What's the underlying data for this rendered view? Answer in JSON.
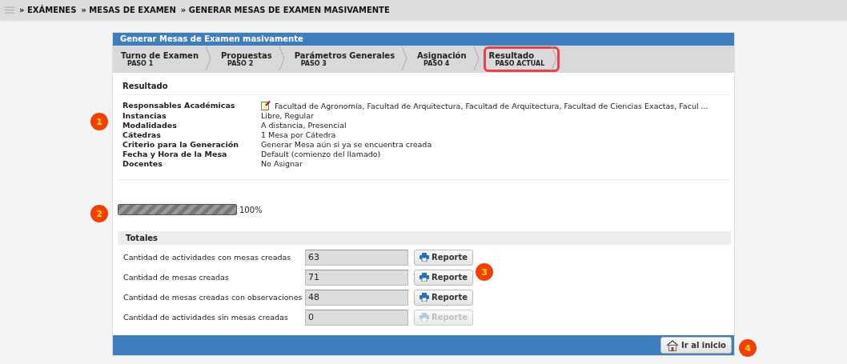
{
  "breadcrumb": [
    "» EXÁMENES",
    "» MESAS DE EXAMEN",
    "» GENERAR MESAS DE EXAMEN MASIVAMENTE"
  ],
  "panel": {
    "title": "Generar Mesas de Examen masivamente"
  },
  "steps": [
    {
      "title": "Turno de Examen",
      "subtitle": "PASO 1",
      "selected": false
    },
    {
      "title": "Propuestas",
      "subtitle": "PASO 2",
      "selected": false
    },
    {
      "title": "Parámetros Generales",
      "subtitle": "PASO 3",
      "selected": false
    },
    {
      "title": "Asignación",
      "subtitle": "PASO 4",
      "selected": false
    },
    {
      "title": "Resultado",
      "subtitle": "PASO ACTUAL",
      "selected": true
    }
  ],
  "summary": {
    "heading": "Resultado",
    "rows": [
      {
        "label": "Responsables Académicas",
        "value": "Facultad de Agronomía, Facultad de Arquitectura, Facultad de Arquitectura, Facultad de Ciencias Exactas, Facul ...",
        "kind": "note"
      },
      {
        "label": "Instancias",
        "value": "Libre, Regular",
        "kind": "plain"
      },
      {
        "label": "Modalidades",
        "value": "A distancia, Presencial",
        "kind": "plain"
      },
      {
        "label": "Cátedras",
        "value": "1 Mesa por Cátedra",
        "kind": "plain"
      },
      {
        "label": "Criterio para la Generación",
        "value": "Generar Mesa aún si ya se encuentra creada",
        "kind": "plain"
      },
      {
        "label": "Fecha y Hora de la Mesa",
        "value": "Default (comienzo del llamado)",
        "kind": "plain"
      },
      {
        "label": "Docentes",
        "value": "No Asignar",
        "kind": "plain"
      }
    ]
  },
  "progress": {
    "level": 1,
    "reading": "100%"
  },
  "totals": {
    "heading": "Totales",
    "rows": [
      {
        "label": "Cantidad de actividades con mesas creadas",
        "value": "63",
        "button": "Reporte",
        "disabled": false
      },
      {
        "label": "Cantidad de mesas creadas",
        "value": "71",
        "button": "Reporte",
        "disabled": false
      },
      {
        "label": "Cantidad de mesas creadas con observaciones",
        "value": "48",
        "button": "Reporte",
        "disabled": false
      },
      {
        "label": "Cantidad de actividades sin mesas creadas",
        "value": "0",
        "button": "Reporte",
        "disabled": true
      }
    ]
  },
  "footer": {
    "button": "Ir al inicio"
  },
  "callouts": [
    "1",
    "2",
    "3",
    "4"
  ]
}
